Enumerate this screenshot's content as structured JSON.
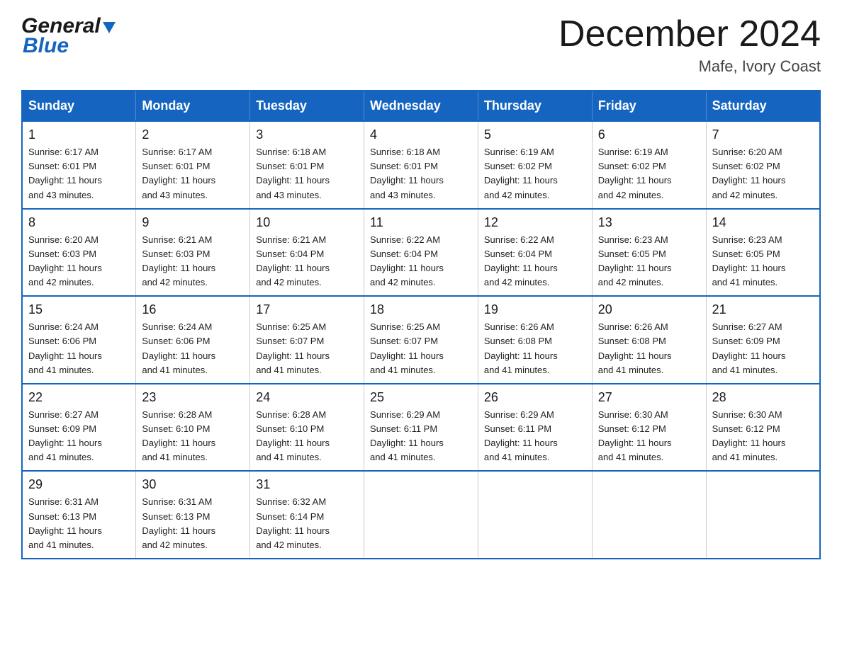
{
  "header": {
    "logo_line1": "General",
    "logo_line2": "Blue",
    "month_title": "December 2024",
    "location": "Mafe, Ivory Coast"
  },
  "days_of_week": [
    "Sunday",
    "Monday",
    "Tuesday",
    "Wednesday",
    "Thursday",
    "Friday",
    "Saturday"
  ],
  "weeks": [
    [
      {
        "day": "1",
        "info": "Sunrise: 6:17 AM\nSunset: 6:01 PM\nDaylight: 11 hours\nand 43 minutes."
      },
      {
        "day": "2",
        "info": "Sunrise: 6:17 AM\nSunset: 6:01 PM\nDaylight: 11 hours\nand 43 minutes."
      },
      {
        "day": "3",
        "info": "Sunrise: 6:18 AM\nSunset: 6:01 PM\nDaylight: 11 hours\nand 43 minutes."
      },
      {
        "day": "4",
        "info": "Sunrise: 6:18 AM\nSunset: 6:01 PM\nDaylight: 11 hours\nand 43 minutes."
      },
      {
        "day": "5",
        "info": "Sunrise: 6:19 AM\nSunset: 6:02 PM\nDaylight: 11 hours\nand 42 minutes."
      },
      {
        "day": "6",
        "info": "Sunrise: 6:19 AM\nSunset: 6:02 PM\nDaylight: 11 hours\nand 42 minutes."
      },
      {
        "day": "7",
        "info": "Sunrise: 6:20 AM\nSunset: 6:02 PM\nDaylight: 11 hours\nand 42 minutes."
      }
    ],
    [
      {
        "day": "8",
        "info": "Sunrise: 6:20 AM\nSunset: 6:03 PM\nDaylight: 11 hours\nand 42 minutes."
      },
      {
        "day": "9",
        "info": "Sunrise: 6:21 AM\nSunset: 6:03 PM\nDaylight: 11 hours\nand 42 minutes."
      },
      {
        "day": "10",
        "info": "Sunrise: 6:21 AM\nSunset: 6:04 PM\nDaylight: 11 hours\nand 42 minutes."
      },
      {
        "day": "11",
        "info": "Sunrise: 6:22 AM\nSunset: 6:04 PM\nDaylight: 11 hours\nand 42 minutes."
      },
      {
        "day": "12",
        "info": "Sunrise: 6:22 AM\nSunset: 6:04 PM\nDaylight: 11 hours\nand 42 minutes."
      },
      {
        "day": "13",
        "info": "Sunrise: 6:23 AM\nSunset: 6:05 PM\nDaylight: 11 hours\nand 42 minutes."
      },
      {
        "day": "14",
        "info": "Sunrise: 6:23 AM\nSunset: 6:05 PM\nDaylight: 11 hours\nand 41 minutes."
      }
    ],
    [
      {
        "day": "15",
        "info": "Sunrise: 6:24 AM\nSunset: 6:06 PM\nDaylight: 11 hours\nand 41 minutes."
      },
      {
        "day": "16",
        "info": "Sunrise: 6:24 AM\nSunset: 6:06 PM\nDaylight: 11 hours\nand 41 minutes."
      },
      {
        "day": "17",
        "info": "Sunrise: 6:25 AM\nSunset: 6:07 PM\nDaylight: 11 hours\nand 41 minutes."
      },
      {
        "day": "18",
        "info": "Sunrise: 6:25 AM\nSunset: 6:07 PM\nDaylight: 11 hours\nand 41 minutes."
      },
      {
        "day": "19",
        "info": "Sunrise: 6:26 AM\nSunset: 6:08 PM\nDaylight: 11 hours\nand 41 minutes."
      },
      {
        "day": "20",
        "info": "Sunrise: 6:26 AM\nSunset: 6:08 PM\nDaylight: 11 hours\nand 41 minutes."
      },
      {
        "day": "21",
        "info": "Sunrise: 6:27 AM\nSunset: 6:09 PM\nDaylight: 11 hours\nand 41 minutes."
      }
    ],
    [
      {
        "day": "22",
        "info": "Sunrise: 6:27 AM\nSunset: 6:09 PM\nDaylight: 11 hours\nand 41 minutes."
      },
      {
        "day": "23",
        "info": "Sunrise: 6:28 AM\nSunset: 6:10 PM\nDaylight: 11 hours\nand 41 minutes."
      },
      {
        "day": "24",
        "info": "Sunrise: 6:28 AM\nSunset: 6:10 PM\nDaylight: 11 hours\nand 41 minutes."
      },
      {
        "day": "25",
        "info": "Sunrise: 6:29 AM\nSunset: 6:11 PM\nDaylight: 11 hours\nand 41 minutes."
      },
      {
        "day": "26",
        "info": "Sunrise: 6:29 AM\nSunset: 6:11 PM\nDaylight: 11 hours\nand 41 minutes."
      },
      {
        "day": "27",
        "info": "Sunrise: 6:30 AM\nSunset: 6:12 PM\nDaylight: 11 hours\nand 41 minutes."
      },
      {
        "day": "28",
        "info": "Sunrise: 6:30 AM\nSunset: 6:12 PM\nDaylight: 11 hours\nand 41 minutes."
      }
    ],
    [
      {
        "day": "29",
        "info": "Sunrise: 6:31 AM\nSunset: 6:13 PM\nDaylight: 11 hours\nand 41 minutes."
      },
      {
        "day": "30",
        "info": "Sunrise: 6:31 AM\nSunset: 6:13 PM\nDaylight: 11 hours\nand 42 minutes."
      },
      {
        "day": "31",
        "info": "Sunrise: 6:32 AM\nSunset: 6:14 PM\nDaylight: 11 hours\nand 42 minutes."
      },
      {
        "day": "",
        "info": ""
      },
      {
        "day": "",
        "info": ""
      },
      {
        "day": "",
        "info": ""
      },
      {
        "day": "",
        "info": ""
      }
    ]
  ]
}
